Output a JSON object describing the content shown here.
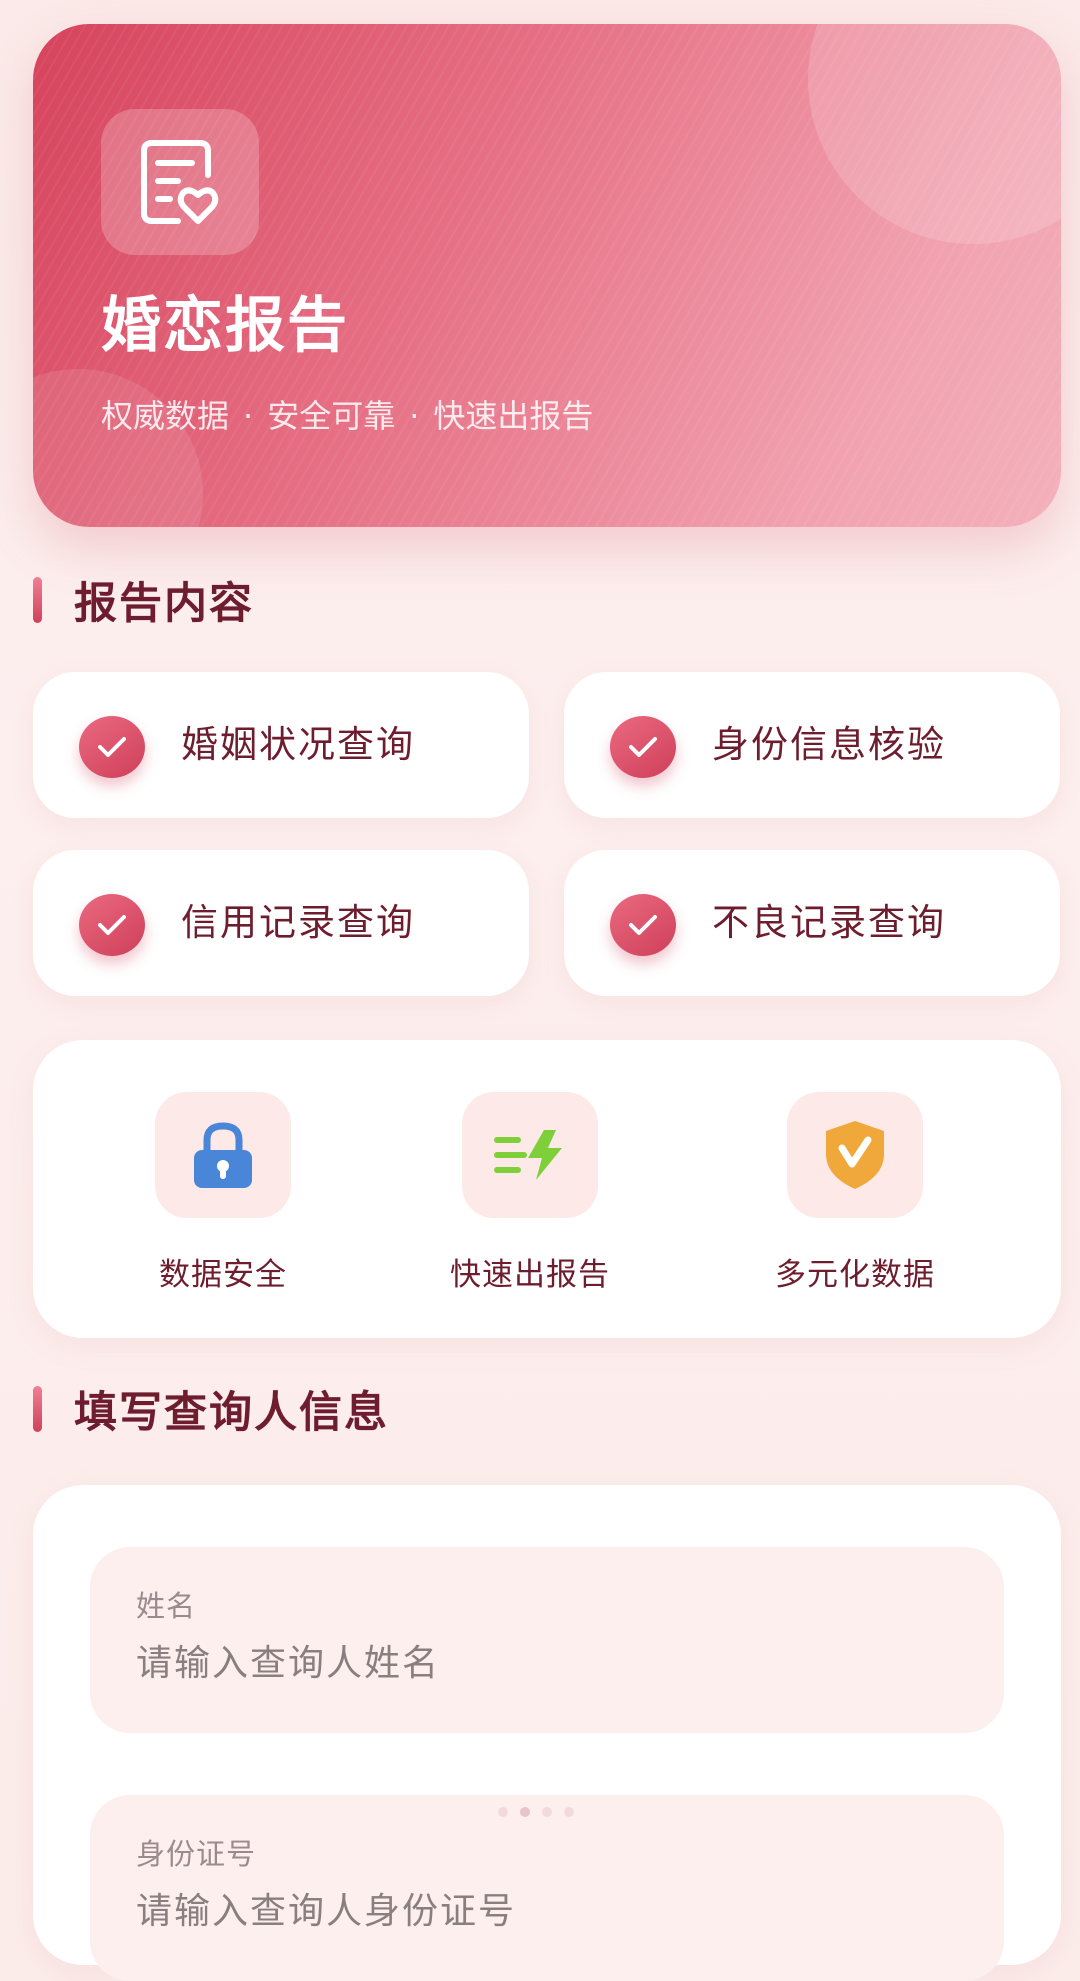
{
  "hero": {
    "title": "婚恋报告",
    "subtitle_parts": [
      "权威数据",
      "安全可靠",
      "快速出报告"
    ],
    "separator": "·",
    "icon": "report-heart-icon"
  },
  "report_section": {
    "title": "报告内容",
    "items": [
      {
        "label": "婚姻状况查询",
        "icon": "check-icon"
      },
      {
        "label": "身份信息核验",
        "icon": "check-icon"
      },
      {
        "label": "信用记录查询",
        "icon": "check-icon"
      },
      {
        "label": "不良记录查询",
        "icon": "check-icon"
      }
    ]
  },
  "features": [
    {
      "label": "数据安全",
      "icon": "lock-icon",
      "color": "#4a86d8"
    },
    {
      "label": "快速出报告",
      "icon": "lightning-icon",
      "color": "#7fcf3a"
    },
    {
      "label": "多元化数据",
      "icon": "shield-check-icon",
      "color": "#f0a83a"
    }
  ],
  "form_section": {
    "title": "填写查询人信息",
    "fields": [
      {
        "label": "姓名",
        "placeholder": "请输入查询人姓名"
      },
      {
        "label": "身份证号",
        "placeholder": "请输入查询人身份证号"
      }
    ]
  },
  "colors": {
    "accent": "#d6435c",
    "heading_text": "#6e1d2e",
    "background": "#fbecea"
  }
}
